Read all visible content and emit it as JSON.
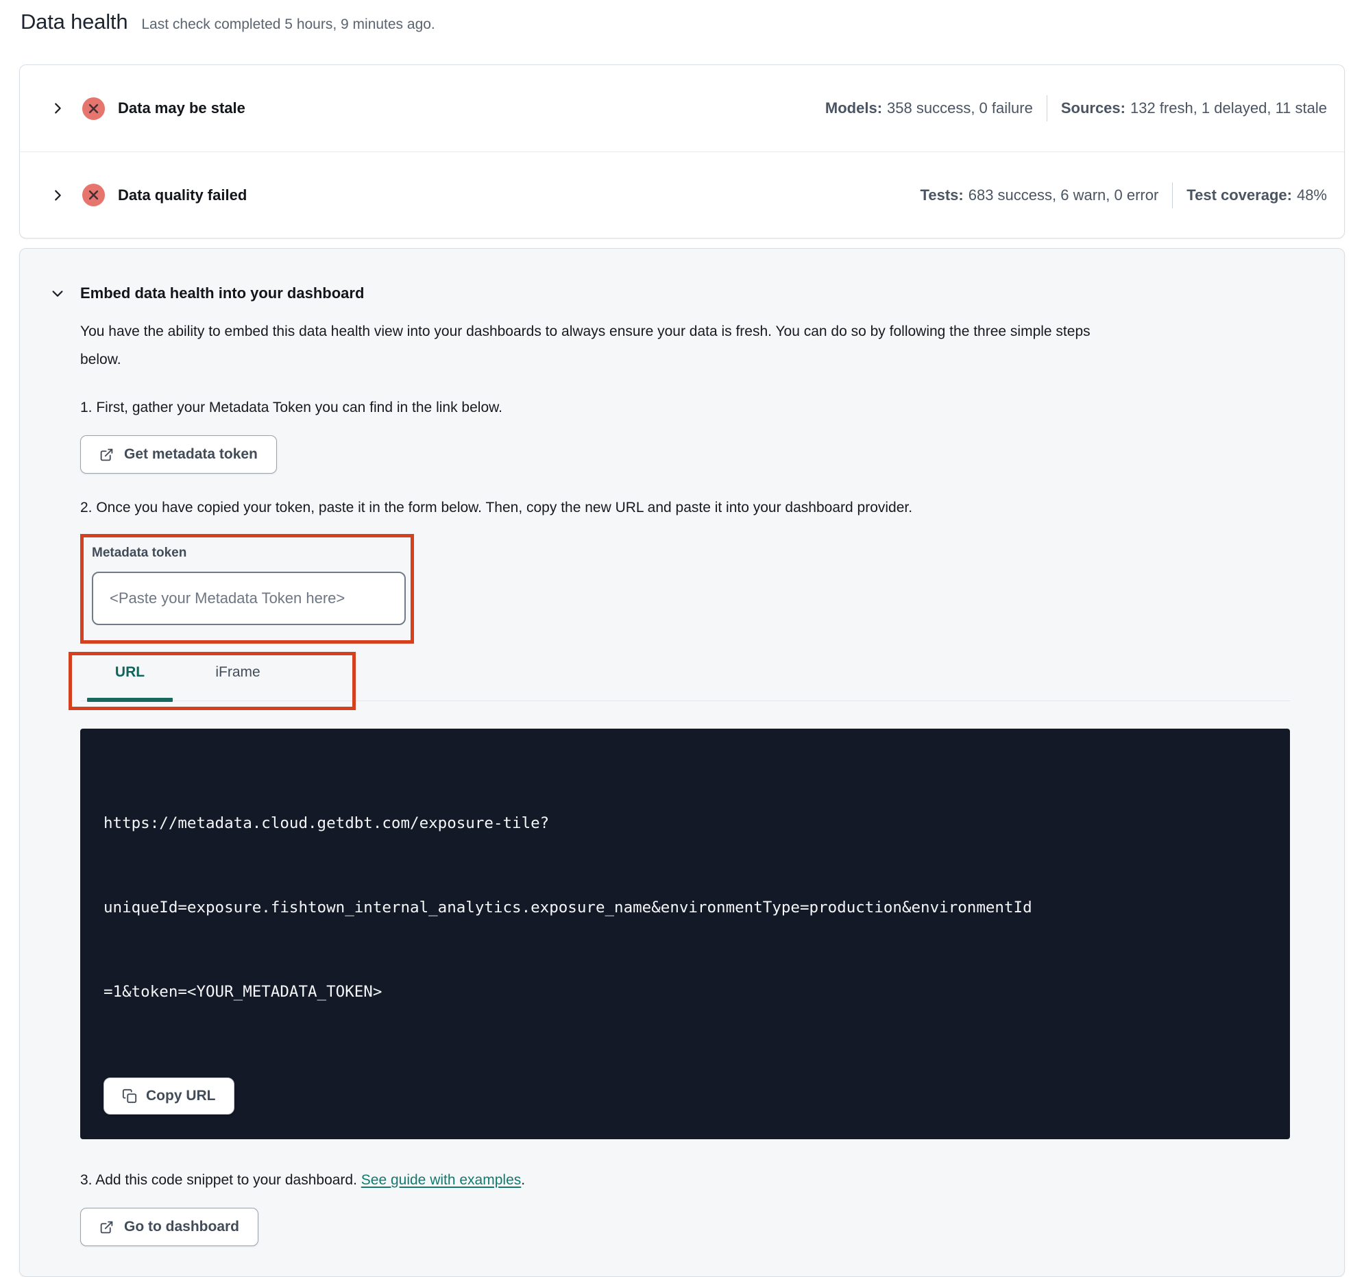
{
  "page": {
    "title": "Data health",
    "subtitle": "Last check completed 5 hours, 9 minutes ago."
  },
  "status_cards": [
    {
      "title": "Data may be stale",
      "status_icon": "error-x-circle",
      "metrics": [
        {
          "label": "Models:",
          "value": "358 success, 0 failure"
        },
        {
          "label": "Sources:",
          "value": "132 fresh, 1 delayed, 11 stale"
        }
      ]
    },
    {
      "title": "Data quality failed",
      "status_icon": "error-x-circle",
      "metrics": [
        {
          "label": "Tests:",
          "value": "683 success, 6 warn, 0 error"
        },
        {
          "label": "Test coverage:",
          "value": "48%"
        }
      ]
    }
  ],
  "embed": {
    "title": "Embed data health into your dashboard",
    "description": "You have the ability to embed this data health view into your dashboards to always ensure your data is fresh. You can do so by following the three simple steps below.",
    "step1": "1. First, gather your Metadata Token you can find in the link below.",
    "get_token_button": "Get metadata token",
    "step2": "2. Once you have copied your token, paste it in the form below. Then, copy the new URL and paste it into your dashboard provider.",
    "token_field": {
      "label": "Metadata token",
      "placeholder": "<Paste your Metadata Token here>",
      "value": ""
    },
    "tabs": [
      {
        "label": "URL"
      },
      {
        "label": "iFrame"
      }
    ],
    "active_tab": "URL",
    "code_lines": [
      "https://metadata.cloud.getdbt.com/exposure-tile?",
      "uniqueId=exposure.fishtown_internal_analytics.exposure_name&environmentType=production&environmentId",
      "=1&token=<YOUR_METADATA_TOKEN>"
    ],
    "copy_button": "Copy URL",
    "step3_prefix": "3. Add this code snippet to your dashboard. ",
    "step3_link": "See guide with examples",
    "step3_suffix": ".",
    "dashboard_button": "Go to dashboard"
  },
  "colors": {
    "annotation_red": "#d5411e",
    "error_badge_salmon": "#e5756d",
    "active_tab_teal": "#0f645c",
    "link_teal": "#117a6e",
    "code_background": "#141927"
  }
}
